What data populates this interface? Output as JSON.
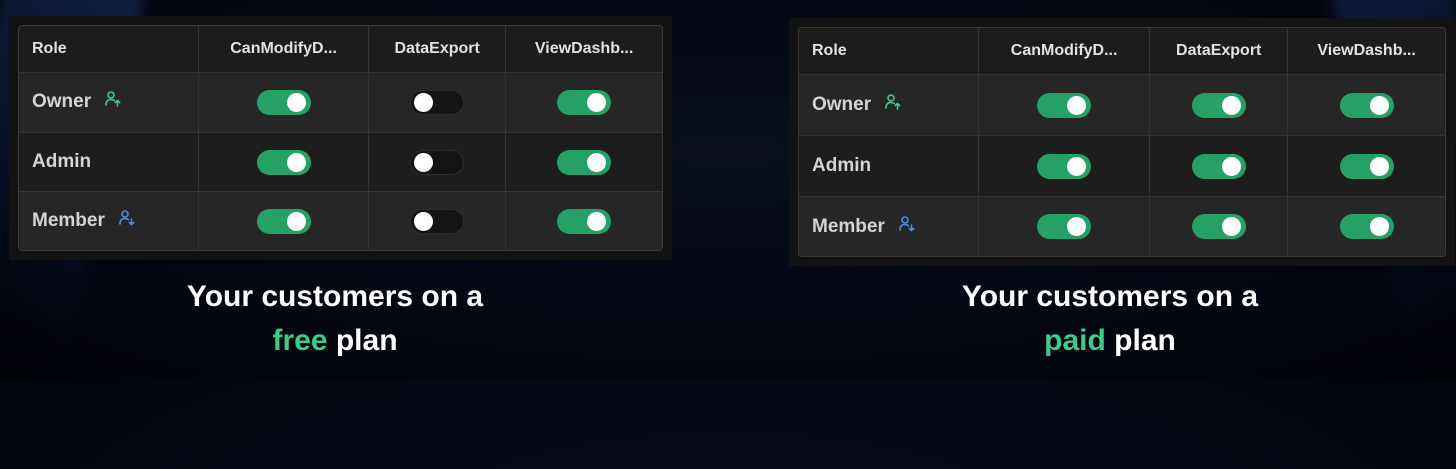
{
  "colors": {
    "accent": "#3dcb8a",
    "toggle_on": "#26a166",
    "owner_icon": "#3dcb8a",
    "member_icon": "#4a90e2"
  },
  "columns": [
    "Role",
    "CanModifyD...",
    "DataExport",
    "ViewDashb..."
  ],
  "roles": [
    {
      "label": "Owner",
      "icon": "user-arrow-up-icon"
    },
    {
      "label": "Admin",
      "icon": ""
    },
    {
      "label": "Member",
      "icon": "user-arrow-down-icon"
    }
  ],
  "free_panel": {
    "caption_line1": "Your customers on a",
    "caption_accent": "free",
    "caption_rest": "plan",
    "permissions": [
      [
        true,
        false,
        true
      ],
      [
        true,
        false,
        true
      ],
      [
        true,
        false,
        true
      ]
    ]
  },
  "paid_panel": {
    "caption_line1": "Your customers on a",
    "caption_accent": "paid",
    "caption_rest": "plan",
    "permissions": [
      [
        true,
        true,
        true
      ],
      [
        true,
        true,
        true
      ],
      [
        true,
        true,
        true
      ]
    ]
  }
}
